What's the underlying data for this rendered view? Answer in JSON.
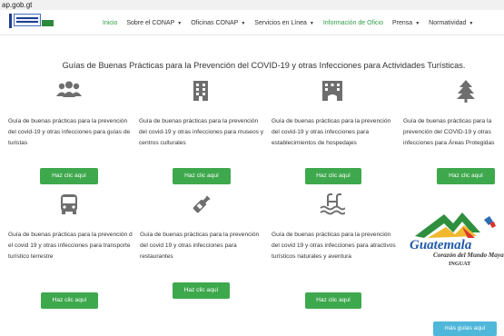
{
  "browser": {
    "url_fragment": "ap.gob.gt"
  },
  "nav": {
    "items": [
      {
        "label": "Inicio",
        "caret": false
      },
      {
        "label": "Sobre el CONAP",
        "caret": true
      },
      {
        "label": "Oficinas CONAP",
        "caret": true
      },
      {
        "label": "Servicios en Línea",
        "caret": true
      },
      {
        "label": "Información de Oficio",
        "caret": false
      },
      {
        "label": "Prensa",
        "caret": true
      },
      {
        "label": "Normatividad",
        "caret": true
      }
    ],
    "caret_glyph": "▼"
  },
  "page_title": "Guías de Buenas Prácticas para la Prevención del COVID-19 y otras Infecciones para Actividades Turísticas.",
  "cards": [
    {
      "icon": "group-icon",
      "desc": "Guía de buenas prácticas para la prevención del covid-19 y otras infecciones para guías de turistas",
      "button": "Haz clic aquí"
    },
    {
      "icon": "building-icon",
      "desc": "Guía de buenas prácticas para la prevención del covid-19 y otras infecciones para museos y centros culturales",
      "button": "Haz clic aquí"
    },
    {
      "icon": "hotel-icon",
      "desc": "Guía de buenas prácticas para la prevención del covid-19 y otras infecciones para establecimientos de hospedajes",
      "button": "Haz clic aquí"
    },
    {
      "icon": "tree-icon",
      "desc": "Guía de buenas prácticas para la prevención del COVID-19 y otras infecciones para Áreas Protegidas",
      "button": "Haz clic aquí"
    },
    {
      "icon": "bus-icon",
      "desc": "Guía de buenas prácticas para la prevención d el covid 19 y otras infecciones para transporte turístico terrestre",
      "button": "Haz clic aquí"
    },
    {
      "icon": "bottle-icon",
      "desc": "Guía de buenas prácticas para la prevención del covid 19 y otras infecciones para restaurantes",
      "button": "Haz clic aquí"
    },
    {
      "icon": "swimmer-icon",
      "desc": "Guía de buenas prácticas para la prevención del covid 19 y otras infecciones para atractivos turísticos naturales y aventura",
      "button": "Haz clic aquí"
    }
  ],
  "inguat_logo": {
    "word": "Guatemala",
    "tagline": "Corazón del Mundo Maya",
    "org": "INGUAT"
  },
  "more_button": "más guías aquí",
  "colors": {
    "green": "#3ea84d",
    "nav_active": "#2e9e48",
    "icon_gray": "#6e6e6e",
    "info_blue": "#4fb7d9"
  }
}
